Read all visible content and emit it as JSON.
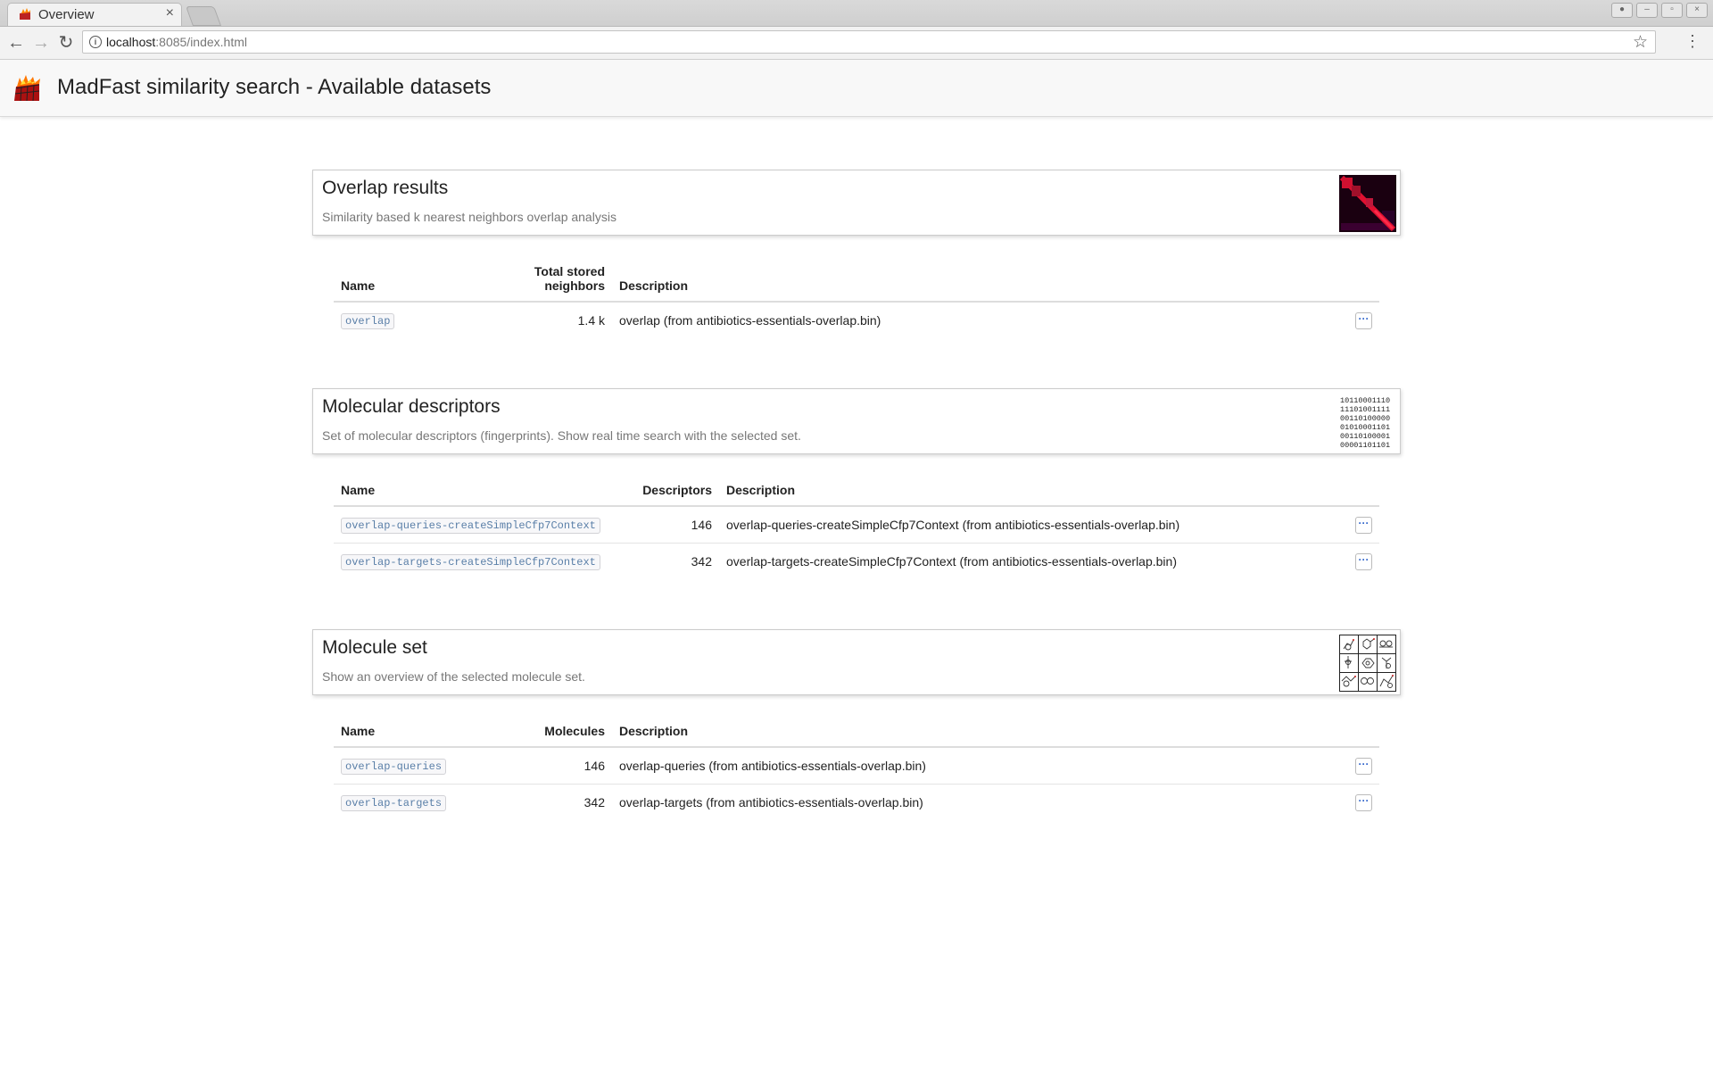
{
  "browser": {
    "tab_title": "Overview",
    "url_host": "localhost",
    "url_rest": ":8085/index.html"
  },
  "header": {
    "title": "MadFast similarity search - Available datasets"
  },
  "sections": [
    {
      "title": "Overlap results",
      "description": "Similarity based k nearest neighbors overlap analysis",
      "columns": [
        "Name",
        "Total stored\nneighbors",
        "Description"
      ],
      "rows": [
        {
          "name": "overlap",
          "value": "1.4 k",
          "description": "overlap (from antibiotics-essentials-overlap.bin)"
        }
      ]
    },
    {
      "title": "Molecular descriptors",
      "description": "Set of molecular descriptors (fingerprints). Show real time search with the selected set.",
      "columns": [
        "Name",
        "Descriptors",
        "Description"
      ],
      "rows": [
        {
          "name": "overlap-queries-createSimpleCfp7Context",
          "value": "146",
          "description": "overlap-queries-createSimpleCfp7Context (from antibiotics-essentials-overlap.bin)"
        },
        {
          "name": "overlap-targets-createSimpleCfp7Context",
          "value": "342",
          "description": "overlap-targets-createSimpleCfp7Context (from antibiotics-essentials-overlap.bin)"
        }
      ]
    },
    {
      "title": "Molecule set",
      "description": "Show an overview of the selected molecule set.",
      "columns": [
        "Name",
        "Molecules",
        "Description"
      ],
      "rows": [
        {
          "name": "overlap-queries",
          "value": "146",
          "description": "overlap-queries (from antibiotics-essentials-overlap.bin)"
        },
        {
          "name": "overlap-targets",
          "value": "342",
          "description": "overlap-targets (from antibiotics-essentials-overlap.bin)"
        }
      ]
    }
  ],
  "icons": {
    "more": "ellipsis-icon",
    "thumb_overlap": "heatmap-icon",
    "thumb_descriptors": "binary-digits-icon",
    "thumb_molecules": "molecule-grid-icon"
  },
  "colors": {
    "code_text": "#5a7fa8",
    "heatmap_bg": "#1a0010",
    "heatmap_diag": "#e01030"
  }
}
